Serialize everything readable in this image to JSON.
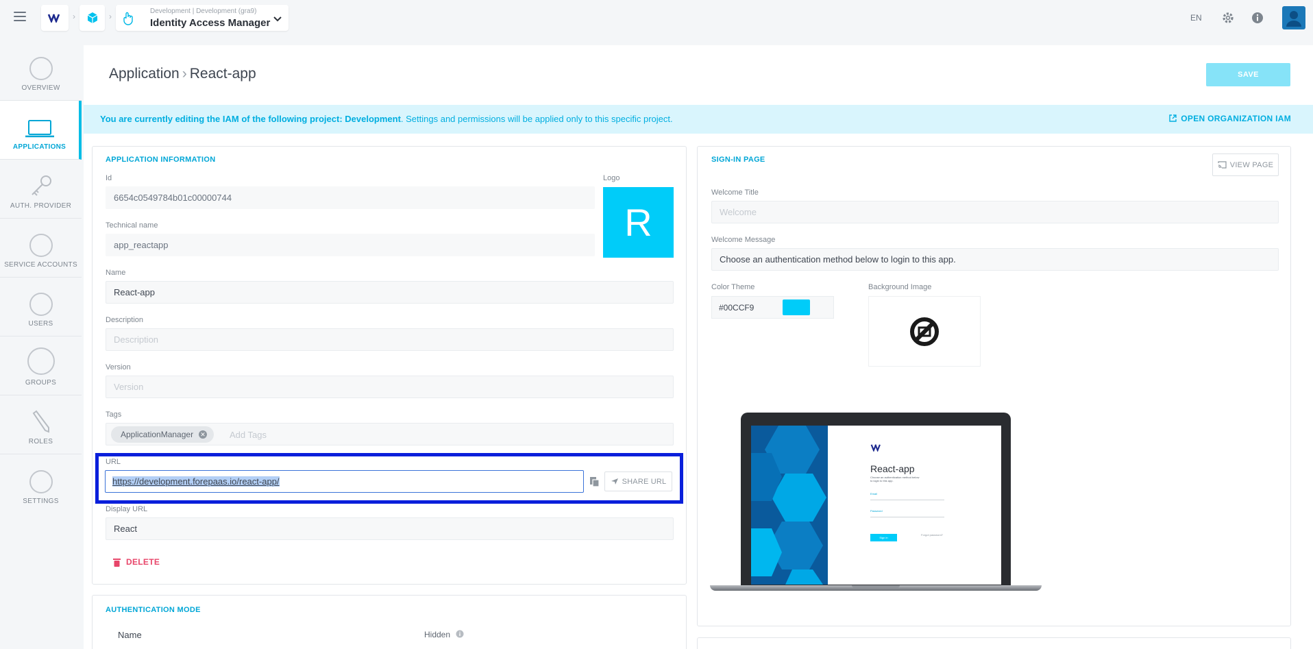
{
  "topbar": {
    "project_sub": "Development | Development (gra9)",
    "project_title": "Identity Access Manager",
    "lang": "EN"
  },
  "sidenav": [
    {
      "label": "OVERVIEW",
      "icon": "overview-gauge-icon"
    },
    {
      "label": "APPLICATIONS",
      "icon": "laptop-icon"
    },
    {
      "label": "AUTH. PROVIDER",
      "icon": "key-icon"
    },
    {
      "label": "SERVICE ACCOUNTS",
      "icon": "fingerprint-icon"
    },
    {
      "label": "USERS",
      "icon": "user-icon"
    },
    {
      "label": "GROUPS",
      "icon": "group-icon"
    },
    {
      "label": "ROLES",
      "icon": "pencil-icon"
    },
    {
      "label": "SETTINGS",
      "icon": "gear-icon"
    }
  ],
  "header": {
    "breadcrumb_root": "Application",
    "breadcrumb_current": "React-app",
    "save_label": "SAVE"
  },
  "banner": {
    "prefix": "You are currently editing the IAM of the following project: Development",
    "suffix": ". Settings and permissions will be applied only to this specific project.",
    "link": "OPEN ORGANIZATION IAM"
  },
  "app_info": {
    "title": "APPLICATION INFORMATION",
    "id_label": "Id",
    "id_value": "6654c0549784b01c00000744",
    "logo_label": "Logo",
    "logo_letter": "R",
    "tech_label": "Technical name",
    "tech_value": "app_reactapp",
    "name_label": "Name",
    "name_value": "React-app",
    "desc_label": "Description",
    "desc_placeholder": "Description",
    "version_label": "Version",
    "version_placeholder": "Version",
    "tags_label": "Tags",
    "tag": "ApplicationManager",
    "tags_placeholder": "Add Tags",
    "url_label": "URL",
    "url_value": "https://development.forepaas.io/react-app/",
    "share_label": "SHARE URL",
    "display_url_label": "Display URL",
    "display_url_value": "React",
    "delete_label": "DELETE"
  },
  "auth_mode": {
    "title": "AUTHENTICATION MODE",
    "col_name": "Name",
    "col_hidden": "Hidden"
  },
  "signin": {
    "title": "SIGN-IN PAGE",
    "view_label": "VIEW PAGE",
    "welcome_title_label": "Welcome Title",
    "welcome_title_placeholder": "Welcome",
    "welcome_message_label": "Welcome Message",
    "welcome_message_value": "Choose an authentication method below to login to this app.",
    "color_label": "Color Theme",
    "color_value": "#00CCF9",
    "bg_label": "Background Image",
    "preview_app_name": "React-app",
    "preview_message": "Choose an authentication method below to login to this app.",
    "preview_email": "Email",
    "preview_password": "Password",
    "preview_signin": "Sign in",
    "preview_forgot": "Forgot password?"
  },
  "colors": {
    "accent": "#00ccf9",
    "accent_text": "#00a6d6",
    "highlight_border": "#0a1fdb",
    "delete": "#e8466a"
  }
}
